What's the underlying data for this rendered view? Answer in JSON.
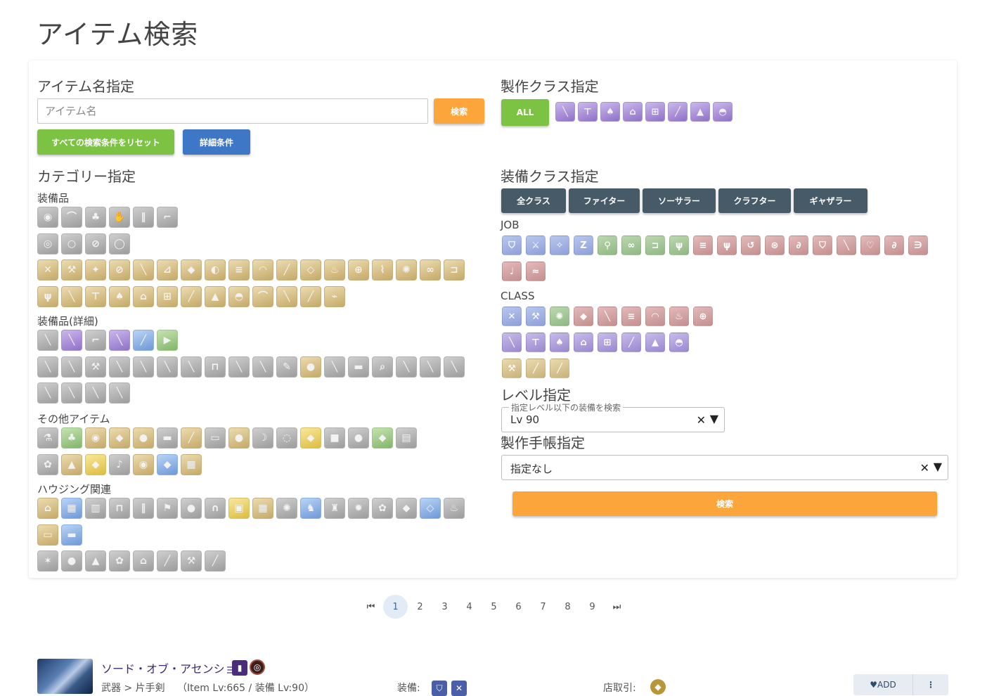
{
  "page": {
    "title": "アイテム検索"
  },
  "name_section": {
    "heading": "アイテム名指定",
    "placeholder": "アイテム名",
    "search_button": "検索",
    "reset_button": "すべての検索条件をリセット",
    "detail_button": "詳細条件"
  },
  "category_section": {
    "heading": "カテゴリー指定",
    "groups": {
      "equipment": "装備品",
      "equipment_detail": "装備品(詳細)",
      "other": "その他アイテム",
      "housing": "ハウジング関連"
    }
  },
  "craft_class_section": {
    "heading": "製作クラス指定",
    "all_button": "ALL",
    "icons": [
      "carpenter-icon",
      "blacksmith-icon",
      "armorer-icon",
      "goldsmith-icon",
      "leatherworker-icon",
      "weaver-icon",
      "alchemist-icon",
      "culinarian-icon"
    ]
  },
  "equip_class_section": {
    "heading": "装備クラス指定",
    "buttons": [
      "全クラス",
      "ファイター",
      "ソーサラー",
      "クラフター",
      "ギャザラー"
    ],
    "job_label": "JOB",
    "class_label": "CLASS"
  },
  "level_section": {
    "heading": "レベル指定",
    "legend": "指定レベル以下の装備を検索",
    "value": "Lv 90"
  },
  "notebook_section": {
    "heading": "製作手帳指定",
    "value": "指定なし"
  },
  "bottom_search_button": "検索",
  "pagination": {
    "first": "⏮",
    "last": "⏭",
    "pages": [
      "1",
      "2",
      "3",
      "4",
      "5",
      "6",
      "7",
      "8",
      "9"
    ],
    "current": "1"
  },
  "result": {
    "name": "ソード・オブ・アセンション",
    "category": "武器 > 片手剣",
    "levels": "（Item Lv:665 / 装備 Lv:90）",
    "equip_label": "装備:",
    "market_label": "店取引:",
    "add_label": "♥ADD",
    "more_label": "⋮"
  },
  "colors": {
    "orange": "#fca53a",
    "green": "#7cc243",
    "blue": "#3f77c7",
    "dark": "#465a67"
  }
}
